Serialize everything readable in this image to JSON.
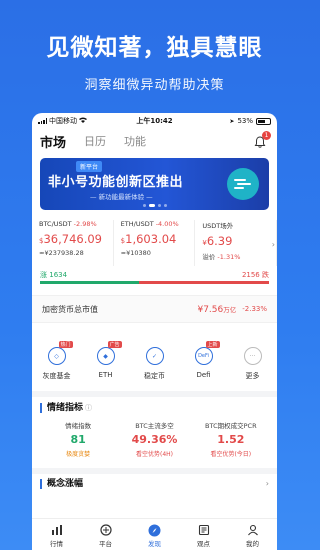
{
  "promo": {
    "title": "见微知著，独具慧眼",
    "subtitle": "洞察细微异动帮助决策"
  },
  "status_bar": {
    "carrier": "中国移动",
    "time": "上午10:42",
    "battery": "53%"
  },
  "nav": {
    "tabs": [
      "市场",
      "日历",
      "功能"
    ],
    "active_tab": "市场",
    "notification_count": "1"
  },
  "banner": {
    "tag": "新平台",
    "title": "非小号功能创新区推出",
    "subtitle": "— 新功能最新体验 —"
  },
  "quotes": [
    {
      "pair": "BTC/USDT",
      "change": "-2.98%",
      "price": "36,746.09",
      "sub": "≈¥237938.28"
    },
    {
      "pair": "ETH/USDT",
      "change": "-4.00%",
      "price": "1,603.04",
      "sub": "≈¥10380"
    },
    {
      "pair": "USDT场外",
      "change": "",
      "price": "6.39",
      "sub": "溢价",
      "sub_change": "-1.31%"
    }
  ],
  "currency_symbol": "$",
  "cny_symbol": "¥",
  "market_breadth": {
    "up_label": "涨",
    "up_count": "1634",
    "down_count": "2156",
    "down_label": "跌",
    "up_fraction": 0.431
  },
  "market_cap": {
    "label": "加密货币总市值",
    "value": "¥7.56",
    "unit": "万亿",
    "change": "-2.33%"
  },
  "shortcuts": [
    {
      "label": "灰度基金",
      "icon": "grayscale-icon",
      "tag": "热门",
      "glyph": "◇"
    },
    {
      "label": "ETH",
      "icon": "eth-icon",
      "tag": "广告",
      "glyph": "◆"
    },
    {
      "label": "稳定币",
      "icon": "stablecoin-icon",
      "tag": "",
      "glyph": "✓"
    },
    {
      "label": "Defi",
      "icon": "defi-icon",
      "tag": "上新",
      "glyph": "DeFi"
    },
    {
      "label": "更多",
      "icon": "more-icon",
      "tag": "",
      "glyph": "···"
    }
  ],
  "sentiment": {
    "title": "情绪指标",
    "items": [
      {
        "label": "情绪指数",
        "value": "81",
        "desc": "极度贪婪"
      },
      {
        "label": "BTC主流多空",
        "value": "49.36%",
        "desc": "看空优势(4H)"
      },
      {
        "label": "BTC期权成交PCR",
        "value": "1.52",
        "desc": "看空优势(今日)"
      }
    ]
  },
  "concept": {
    "title": "概念涨幅"
  },
  "tabbar": [
    {
      "label": "行情",
      "icon": "chart-icon"
    },
    {
      "label": "平台",
      "icon": "platform-icon"
    },
    {
      "label": "发现",
      "icon": "compass-icon"
    },
    {
      "label": "观点",
      "icon": "news-icon"
    },
    {
      "label": "我的",
      "icon": "user-icon"
    }
  ],
  "colors": {
    "brand_blue": "#2f6fdb",
    "up_green": "#21a96b",
    "down_red": "#e24a4a"
  }
}
